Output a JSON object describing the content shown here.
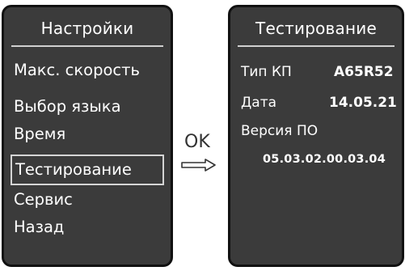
{
  "left_screen": {
    "title": "Настройки",
    "menu": [
      {
        "label": "Макс. скорость"
      },
      {
        "label": "Выбор языка"
      },
      {
        "label": "Время"
      },
      {
        "label": "Тестирование",
        "selected": true
      },
      {
        "label": "Сервис"
      },
      {
        "label": "Назад"
      }
    ]
  },
  "transition": {
    "label": "OK",
    "icon": "right-arrow-icon"
  },
  "right_screen": {
    "title": "Тестирование",
    "gearbox_type_label": "Тип КП",
    "gearbox_type_value": "A65R52",
    "date_label": "Дата",
    "date_value": "14.05.21",
    "software_version_label": "Версия ПО",
    "software_version_value": "05.03.02.00.03.04"
  },
  "colors": {
    "screen_background": "#3b3b3b",
    "text": "#ffffff",
    "selection_border": "#d5d5d5"
  }
}
